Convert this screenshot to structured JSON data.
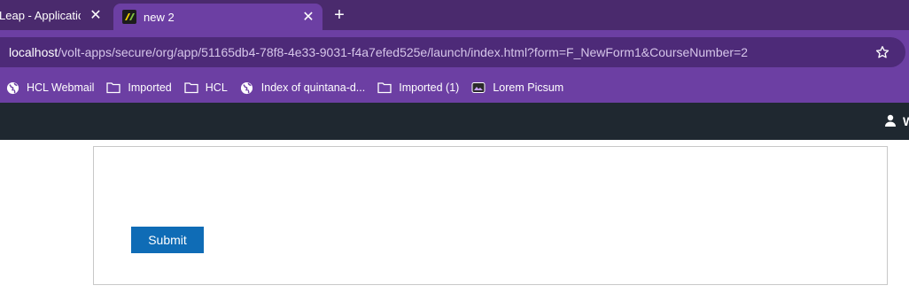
{
  "browser": {
    "tabs": [
      {
        "title": "Leap - Application",
        "active": false
      },
      {
        "title": "new 2",
        "active": true
      }
    ],
    "close_glyph": "✕",
    "new_tab_glyph": "+",
    "address": {
      "host": "localhost",
      "path": "/volt-apps/secure/org/app/51165db4-78f8-4e33-9031-f4a7efed525e/launch/index.html?form=F_NewForm1&CourseNumber=2"
    },
    "bookmarks": [
      {
        "label": "HCL Webmail",
        "icon": "globe-icon"
      },
      {
        "label": "Imported",
        "icon": "folder-icon"
      },
      {
        "label": "HCL",
        "icon": "folder-icon"
      },
      {
        "label": "Index of quintana-d...",
        "icon": "globe-icon"
      },
      {
        "label": "Imported (1)",
        "icon": "folder-icon"
      },
      {
        "label": "Lorem Picsum",
        "icon": "image-icon"
      }
    ]
  },
  "app": {
    "user_label": "W"
  },
  "form": {
    "submit_label": "Submit"
  },
  "colors": {
    "tabstrip": "#4a2a6d",
    "toolbar": "#6c3fa3",
    "appbar": "#1f2830",
    "submit": "#0f6cb6"
  }
}
